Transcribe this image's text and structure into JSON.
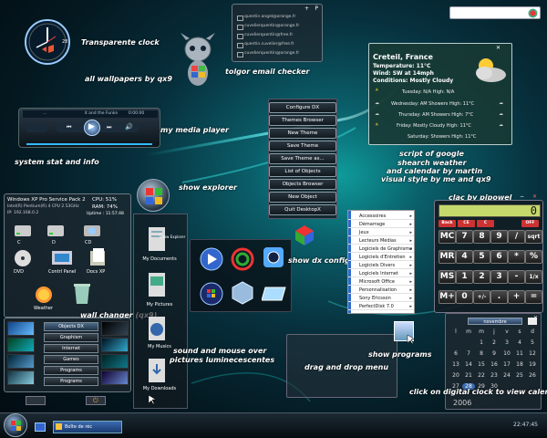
{
  "captions": {
    "clock": "Transparente clock",
    "wallpapers": "all wallpapers by qx9",
    "email": "tolgor email checker",
    "player": "my media player",
    "system": "system stat and info",
    "explorer": "show explorer",
    "dxconfig": "show dx config",
    "wallchanger": "wall changer (qx9)",
    "sound1": "sound and mouse over",
    "sound2": "pictures luminecescentes",
    "programs": "show programs",
    "dragdrop": "drag  and drop menu",
    "calendarhint": "click on digital clock to view calendar",
    "google1": "script of google",
    "google2": "shearch weather",
    "google3": "and calendar by martin",
    "google4": "visual style by me and qx9",
    "calc": "clac by pjpowel"
  },
  "clock": {
    "day": "28"
  },
  "email": {
    "entries": [
      "quentin.angel@orange.fr",
      "cuvelierquentin@orange.fr",
      "cuvelierquentin@free.fr",
      "quentin.cuvelier@free.fr",
      "cuvelierquentin@orange.fr"
    ]
  },
  "player": {
    "title": "...",
    "track": "it and the Funkn",
    "time": "0:00:00"
  },
  "dx": {
    "buttons": [
      "Configure DX",
      "Themes Browser",
      "New Theme",
      "Save Theme",
      "Save Theme as...",
      "List of Objects",
      "Objects Browser",
      "New Object",
      "Quit DesktopX"
    ]
  },
  "weather": {
    "city": "Creteil, France",
    "temp": "Temperature: 11°C",
    "wind": "Wind: SW at 14mph",
    "cond": "Conditions: Mostly Cloudy",
    "forecast": [
      "Tuesday: N/A High: N/A",
      "Wednesday: AM Showers High: 11°C",
      "Thursday: AM Showers High: 7°C",
      "Friday: Mostly Cloudy High: 11°C",
      "Saturday: Showers High: 11°C"
    ]
  },
  "sysinfo": {
    "os": "Windows XP Pro Service Pack 2",
    "cpu": "Intel(R) Pentium(R) 4 CPU 2.53GHz",
    "ip": "IP: 192.168.0.2",
    "cpuload": "CPU: 51%",
    "ram": "RAM: 74%",
    "uptime": "Uptime : 11:57:48",
    "drives": [
      "C",
      "D",
      "CD",
      "DVD",
      "Contrl Panel",
      "Docs XP"
    ],
    "weather_label": "Weather"
  },
  "objects": [
    "Objects DX",
    "Graphism",
    "Internet",
    "Games",
    "Programs",
    "Programs"
  ],
  "explorer": {
    "label": "Show Explorer",
    "items": [
      "My Documents",
      "My Pictures",
      "My Musics",
      "My Downloads"
    ]
  },
  "startmenu": [
    "Accessoires",
    "Démarrage",
    "Jeux",
    "Lecteurs Médias",
    "Logiciels de Graphisme",
    "Logiciels d'Entretien",
    "Logiciels Divers",
    "Logiciels Internet",
    "Microsoft Office",
    "Personnalisation",
    "Sony Ericsson",
    "PerfectDisk 7.0"
  ],
  "calc": {
    "display": "0",
    "row0": [
      "Back",
      "CE",
      "C",
      "OFF"
    ],
    "keys": [
      "MC",
      "7",
      "8",
      "9",
      "/",
      "sqrt",
      "MR",
      "4",
      "5",
      "6",
      "*",
      "%",
      "MS",
      "1",
      "2",
      "3",
      "-",
      "1/x",
      "M+",
      "0",
      "+/-",
      ".",
      "+",
      "="
    ]
  },
  "calendar": {
    "month": "novembre",
    "year": "2006",
    "head": [
      "l",
      "m",
      "m",
      "j",
      "v",
      "s",
      "d"
    ],
    "days": [
      "1",
      "2",
      "3",
      "4",
      "5",
      "6",
      "7",
      "8",
      "9",
      "10",
      "11",
      "12",
      "13",
      "14",
      "15",
      "16",
      "17",
      "18",
      "19",
      "20",
      "21",
      "22",
      "23",
      "24",
      "25",
      "26",
      "27",
      "28",
      "29",
      "30"
    ],
    "today": "28"
  },
  "taskbar": {
    "task": "Boîte de réc",
    "time": "22:47:45"
  }
}
